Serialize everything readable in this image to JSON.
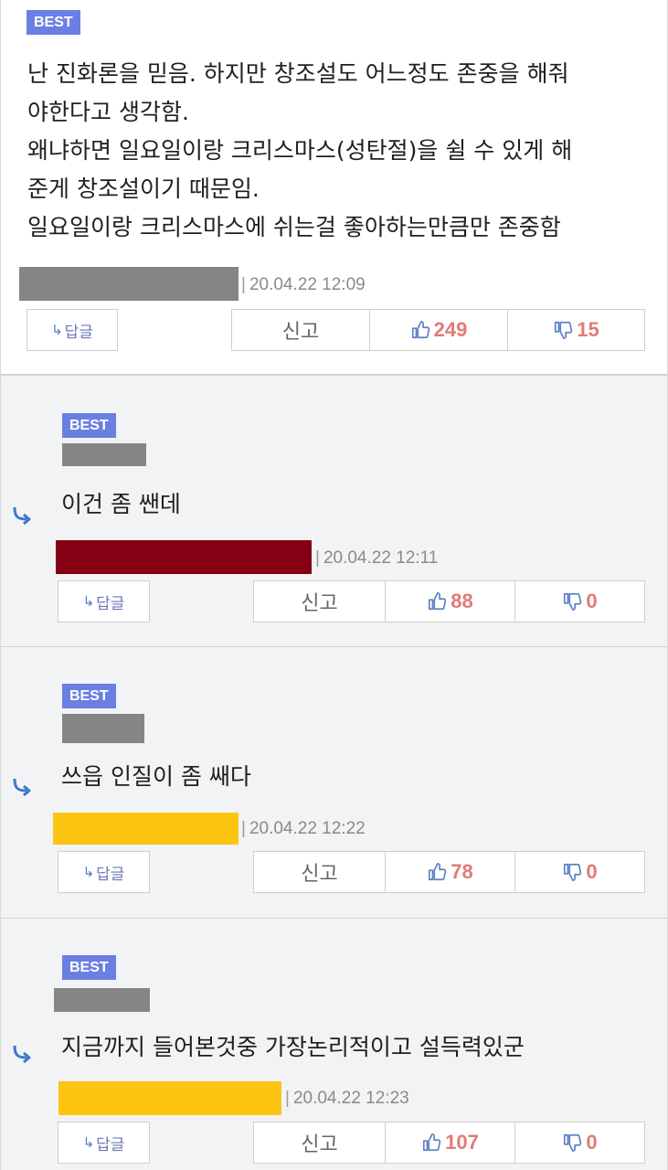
{
  "colors": {
    "badge": "#6b7fe3",
    "count": "#e27a77",
    "icon": "#5b7fc4",
    "reply_bg": "#f2f3f5",
    "redacted_gray": "#858585",
    "redacted_red": "#850012",
    "redacted_yellow": "#fcc512"
  },
  "labels": {
    "best": "BEST",
    "answer": "답글",
    "report": "신고",
    "separator": "|"
  },
  "comments": [
    {
      "lines": [
        "난 진화론을 믿음. 하지만 창조설도 어느정도 존중을 해줘",
        "야한다고 생각함.",
        "왜냐하면 일요일이랑 크리스마스(성탄절)을 쉴 수 있게 해",
        "준게 창조설이기 때문임.",
        "일요일이랑 크리스마스에 쉬는걸 좋아하는만큼만 존중함"
      ],
      "date": "20.04.22 12:09",
      "likes": "249",
      "dislikes": "15"
    },
    {
      "text": "이건 좀 쌘데",
      "date": "20.04.22 12:11",
      "likes": "88",
      "dislikes": "0"
    },
    {
      "text": "쓰읍 인질이 좀 쌔다",
      "date": "20.04.22 12:22",
      "likes": "78",
      "dislikes": "0"
    },
    {
      "text": "지금까지 들어본것중 가장논리적이고 설득력있군",
      "date": "20.04.22 12:23",
      "likes": "107",
      "dislikes": "0"
    }
  ]
}
